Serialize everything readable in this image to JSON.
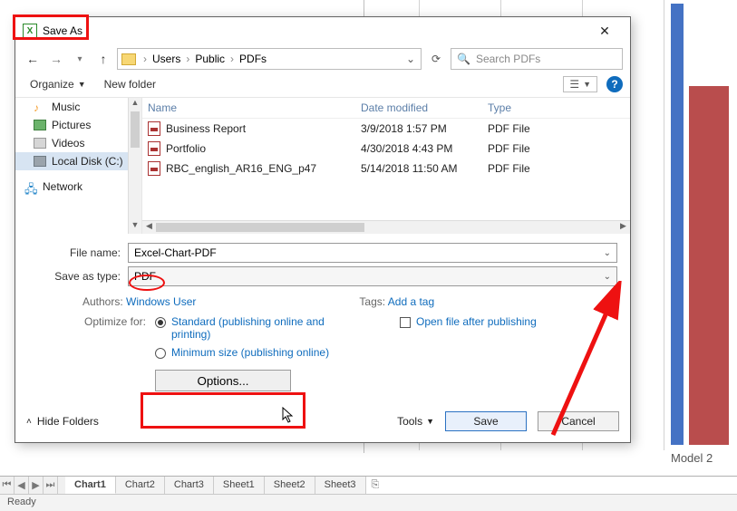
{
  "window": {
    "title": "Save As",
    "close": "✕"
  },
  "nav": {
    "back": "←",
    "fwd": "→",
    "up": "↑",
    "crumbs": [
      "Users",
      "Public",
      "PDFs"
    ],
    "refresh": "⟳",
    "search_placeholder": "Search PDFs"
  },
  "toolbar": {
    "organize": "Organize",
    "newfolder": "New folder",
    "help": "?"
  },
  "navpane": {
    "items": [
      {
        "label": "Music",
        "icon": "music"
      },
      {
        "label": "Pictures",
        "icon": "pic"
      },
      {
        "label": "Videos",
        "icon": "vid"
      },
      {
        "label": "Local Disk (C:)",
        "icon": "disk",
        "selected": true
      },
      {
        "label": "Network",
        "icon": "net"
      }
    ]
  },
  "list": {
    "columns": {
      "name": "Name",
      "date": "Date modified",
      "type": "Type"
    },
    "rows": [
      {
        "name": "Business Report",
        "date": "3/9/2018 1:57 PM",
        "type": "PDF File"
      },
      {
        "name": "Portfolio",
        "date": "4/30/2018 4:43 PM",
        "type": "PDF File"
      },
      {
        "name": "RBC_english_AR16_ENG_p47",
        "date": "5/14/2018 11:50 AM",
        "type": "PDF File"
      }
    ]
  },
  "form": {
    "filename_label": "File name:",
    "filename_value": "Excel-Chart-PDF",
    "saveas_label": "Save as type:",
    "saveas_value": "PDF"
  },
  "meta": {
    "authors_label": "Authors:",
    "authors_value": "Windows User",
    "tags_label": "Tags:",
    "tags_value": "Add a tag"
  },
  "optimize": {
    "label": "Optimize for:",
    "opt1": "Standard (publishing online and printing)",
    "opt2": "Minimum size (publishing online)",
    "openfile": "Open file after publishing",
    "options_btn": "Options..."
  },
  "buttons": {
    "hide": "Hide Folders",
    "tools": "Tools",
    "save": "Save",
    "cancel": "Cancel"
  },
  "excel": {
    "tabs": [
      "Chart1",
      "Chart2",
      "Chart3",
      "Sheet1",
      "Sheet2",
      "Sheet3"
    ],
    "status": "Ready",
    "model": "Model 2"
  }
}
